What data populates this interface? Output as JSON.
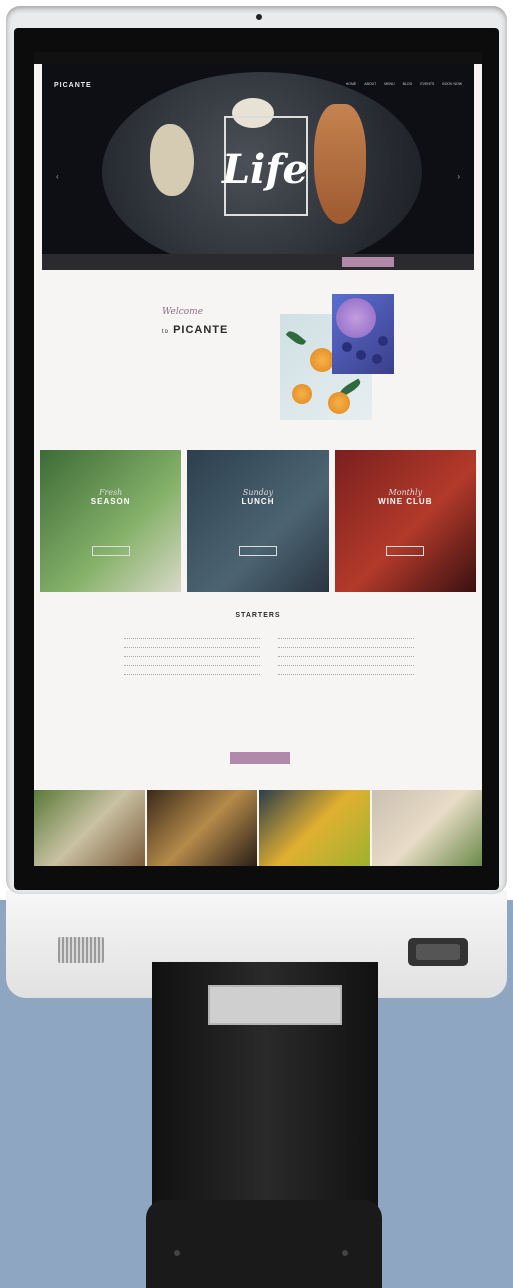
{
  "site": {
    "topbar_text": "",
    "logo": "PICANTE",
    "nav": [
      "HOME",
      "ABOUT",
      "MENU",
      "BLOG",
      "EVENTS",
      "BOOK NOW"
    ],
    "hero_word": "Life",
    "hero_sub": "",
    "booking": {
      "field_date": "",
      "field_time": "",
      "field_guests": "",
      "button": ""
    },
    "welcome_script": "Welcome",
    "welcome_to": "to",
    "brand": "PICANTE",
    "welcome_text": "",
    "signature": "",
    "cards": [
      {
        "script": "Fresh",
        "title": "SEASON",
        "desc": "",
        "button": ""
      },
      {
        "script": "Sunday",
        "title": "LUNCH",
        "desc": "",
        "button": ""
      },
      {
        "script": "Monthly",
        "title": "WINE CLUB",
        "desc": "",
        "button": ""
      }
    ],
    "starters_title": "STARTERS",
    "menu_items": [
      {
        "name": "",
        "desc": "",
        "price": ""
      },
      {
        "name": "",
        "desc": "",
        "price": ""
      },
      {
        "name": "",
        "desc": "",
        "price": ""
      },
      {
        "name": "",
        "desc": "",
        "price": ""
      },
      {
        "name": "",
        "desc": "",
        "price": ""
      },
      {
        "name": "",
        "desc": "",
        "price": ""
      },
      {
        "name": "",
        "desc": "",
        "price": ""
      },
      {
        "name": "",
        "desc": "",
        "price": ""
      },
      {
        "name": "",
        "desc": "",
        "price": ""
      },
      {
        "name": "",
        "desc": "",
        "price": ""
      }
    ],
    "all_menu_button": "",
    "gallery_label": "",
    "colors": {
      "accent": "#b18aa9",
      "dark": "#0d0f14",
      "kiosk_bg": "#8ea6c1"
    }
  }
}
